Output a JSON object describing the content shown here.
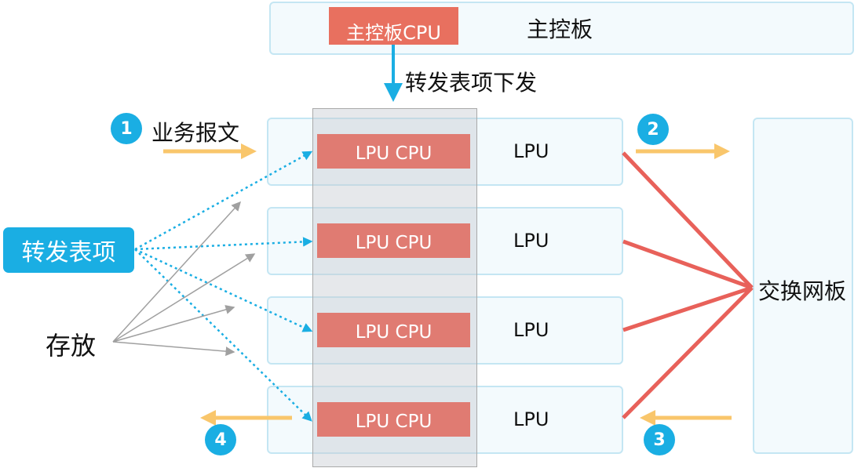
{
  "main_board": {
    "label": "主控板",
    "cpu_label": "主控板CPU"
  },
  "arrow_label": "转发表项下发",
  "service_packet_label": "业务报文",
  "forwarding_entry_label": "转发表项",
  "store_label": "存放",
  "switch_fabric_label": "交换网板",
  "lpus": [
    {
      "label": "LPU",
      "cpu_label": "LPU CPU"
    },
    {
      "label": "LPU",
      "cpu_label": "LPU CPU"
    },
    {
      "label": "LPU",
      "cpu_label": "LPU CPU"
    },
    {
      "label": "LPU",
      "cpu_label": "LPU CPU"
    }
  ],
  "steps": [
    "1",
    "2",
    "3",
    "4"
  ],
  "colors": {
    "accent_blue": "#1aaee3",
    "cpu_red": "#e07b72",
    "link_red": "#e8615a",
    "flow_yellow": "#f9c66b",
    "board_fill": "#f3fafd",
    "board_border": "#c4e6f3"
  }
}
